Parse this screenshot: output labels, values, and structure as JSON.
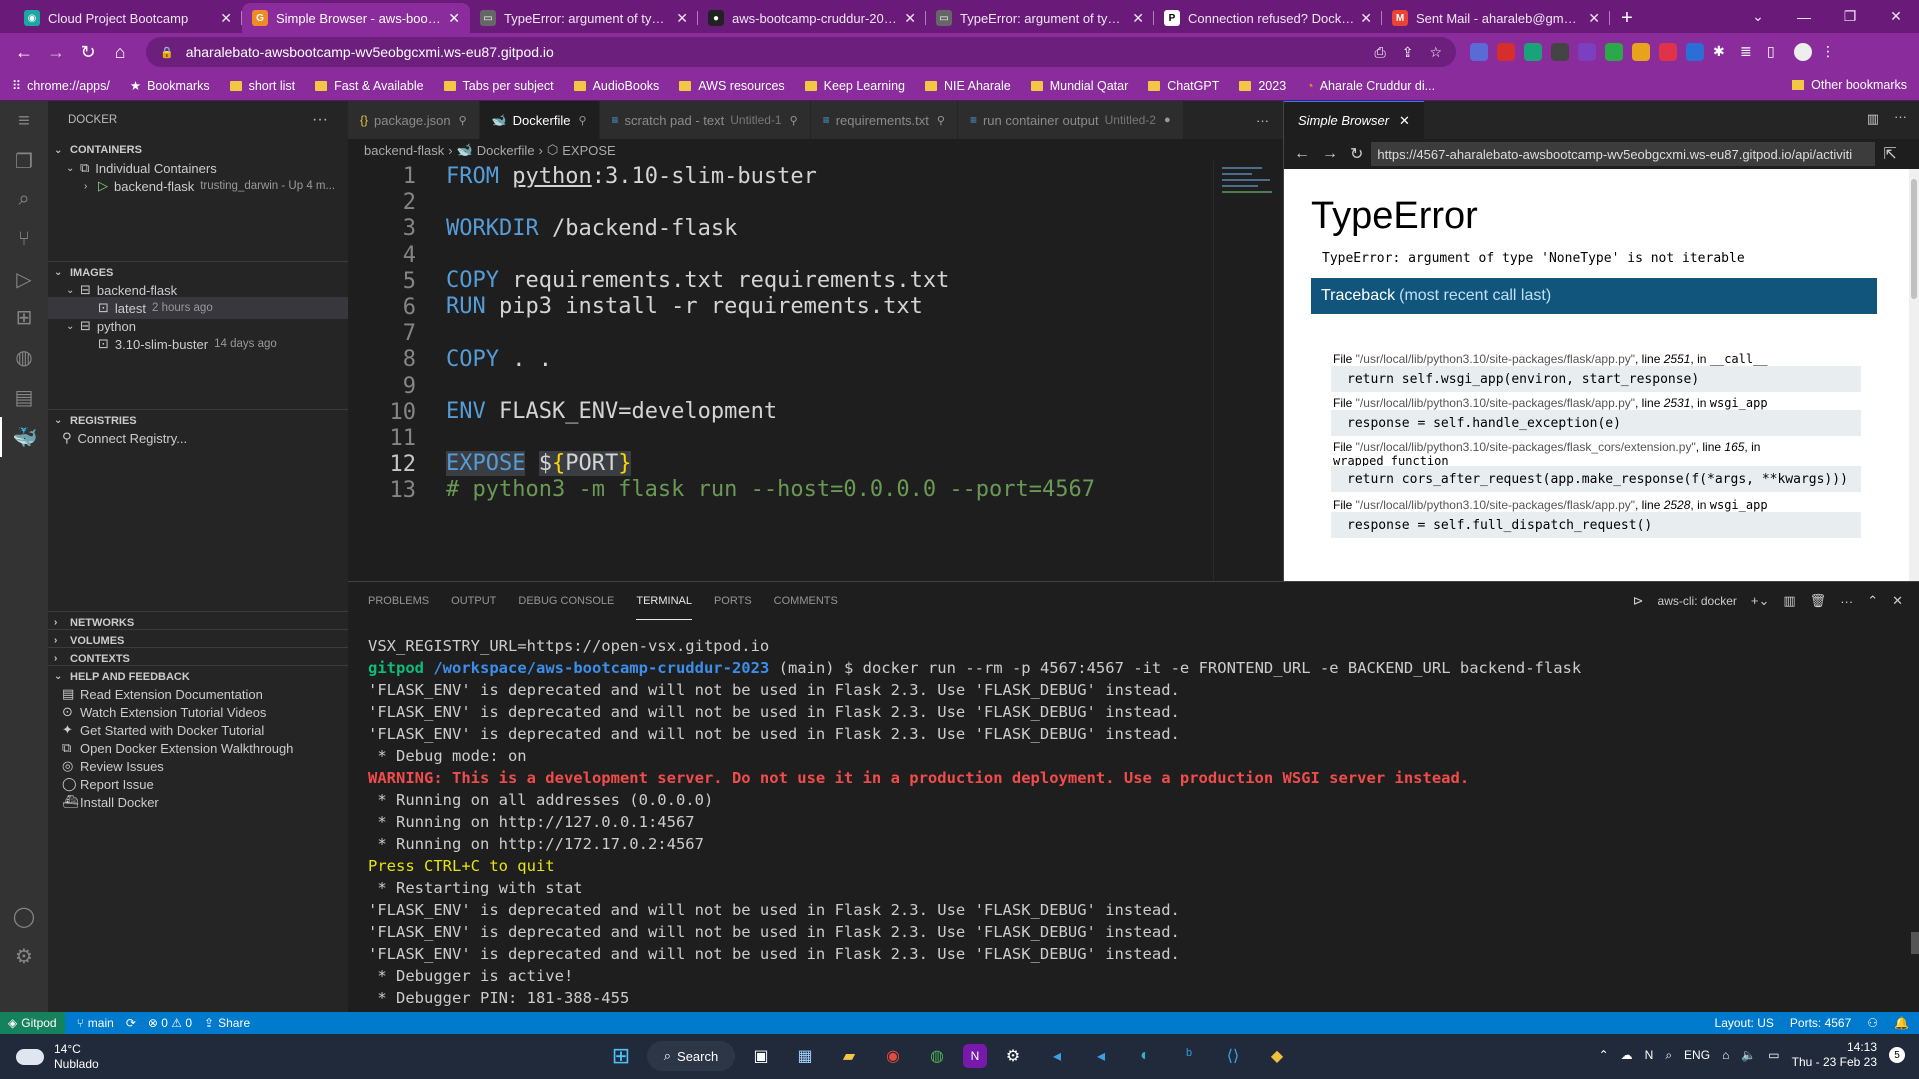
{
  "chrome": {
    "tabs": [
      {
        "title": "Cloud Project Bootcamp",
        "fav": "#1aa8a3",
        "glyph": "◉"
      },
      {
        "title": "Simple Browser - aws-bootcamp",
        "fav": "#f08a24",
        "glyph": "G",
        "active": true
      },
      {
        "title": "TypeError: argument of type 'N",
        "fav": "#666",
        "glyph": "▭"
      },
      {
        "title": "aws-bootcamp-cruddur-2023/",
        "fav": "#222",
        "glyph": "●"
      },
      {
        "title": "TypeError: argument of type 'N",
        "fav": "#666",
        "glyph": "▭"
      },
      {
        "title": "Connection refused? Docker ne",
        "fav": "#fff",
        "glyph": "P"
      },
      {
        "title": "Sent Mail - aharaleb@gmail.co",
        "fav": "#ea4335",
        "glyph": "M"
      }
    ],
    "new_tab": "+",
    "url": "aharalebato-awsbootcamp-wv5eobgcxmi.ws-eu87.gitpod.io",
    "bookmarks": [
      "chrome://apps/",
      "Bookmarks",
      "short list",
      "Fast & Available",
      "Tabs per subject",
      "AudioBooks",
      "AWS resources",
      "Keep Learning",
      "NIE Aharale",
      "Mundial Qatar",
      "ChatGPT",
      "2023",
      "Aharale Cruddur di..."
    ],
    "other_bookmarks": "Other bookmarks"
  },
  "sidebar": {
    "title": "DOCKER",
    "containers": "CONTAINERS",
    "individual": "Individual Containers",
    "container_name": "backend-flask",
    "container_status": "trusting_darwin - Up 4 m...",
    "images": "IMAGES",
    "img1": "backend-flask",
    "img1_tag": "latest",
    "img1_age": "2 hours ago",
    "img2": "python",
    "img2_tag": "3.10-slim-buster",
    "img2_age": "14 days ago",
    "registries": "REGISTRIES",
    "connect": "Connect Registry...",
    "networks": "NETWORKS",
    "volumes": "VOLUMES",
    "contexts": "CONTEXTS",
    "help": "HELP AND FEEDBACK",
    "help_items": [
      "Read Extension Documentation",
      "Watch Extension Tutorial Videos",
      "Get Started with Docker Tutorial",
      "Open Docker Extension Walkthrough",
      "Review Issues",
      "Report Issue",
      "Install Docker"
    ]
  },
  "editor": {
    "tabs": [
      {
        "label": "package.json",
        "icon": "{}"
      },
      {
        "label": "Dockerfile",
        "icon": "🐋",
        "active": true
      },
      {
        "label": "scratch pad - text",
        "dim": "Untitled-1",
        "icon": "≡"
      },
      {
        "label": "requirements.txt",
        "icon": "≡"
      },
      {
        "label": "run container output",
        "dim": "Untitled-2",
        "icon": "≡"
      }
    ],
    "crumbs": [
      "backend-flask",
      "Dockerfile",
      "EXPOSE"
    ],
    "line_numbers": [
      "1",
      "2",
      "3",
      "4",
      "5",
      "6",
      "7",
      "8",
      "9",
      "10",
      "11",
      "12",
      "13"
    ]
  },
  "simple_browser": {
    "tab": "Simple Browser",
    "url": "https://4567-aharalebato-awsbootcamp-wv5eobgcxmi.ws-eu87.gitpod.io/api/activiti",
    "title": "TypeError",
    "message": "TypeError: argument of type 'NoneType' is not iterable",
    "traceback": "Traceback",
    "traceback_sub": "(most recent call last)",
    "frames": [
      {
        "file": "\"/usr/local/lib/python3.10/site-packages/flask/app.py\"",
        "line": "2551",
        "fn": "__call__",
        "src": "return self.wsgi_app(environ, start_response)"
      },
      {
        "file": "\"/usr/local/lib/python3.10/site-packages/flask/app.py\"",
        "line": "2531",
        "fn": "wsgi_app",
        "src": "response = self.handle_exception(e)"
      },
      {
        "file": "\"/usr/local/lib/python3.10/site-packages/flask_cors/extension.py\"",
        "line": "165",
        "fn": "wrapped_function",
        "src": "return cors_after_request(app.make_response(f(*args, **kwargs)))"
      },
      {
        "file": "\"/usr/local/lib/python3.10/site-packages/flask/app.py\"",
        "line": "2528",
        "fn": "wsgi_app",
        "src": "response = self.full_dispatch_request()"
      }
    ]
  },
  "panel": {
    "tabs": [
      "PROBLEMS",
      "OUTPUT",
      "DEBUG CONSOLE",
      "TERMINAL",
      "PORTS",
      "COMMENTS"
    ],
    "active": "TERMINAL",
    "shell": "aws-cli: docker",
    "prompt_user": "gitpod",
    "prompt_path": "/workspace/aws-bootcamp-cruddur-2023",
    "prompt_branch": "(main) $",
    "command": "docker run --rm -p 4567:4567 -it -e FRONTEND_URL -e BACKEND_URL backend-flask",
    "lines": {
      "env1": "VSX_REGISTRY_URL=https://open-vsx.gitpod.io",
      "dep": "'FLASK_ENV' is deprecated and will not be used in Flask 2.3. Use 'FLASK_DEBUG' instead.",
      "debug": " * Debug mode: on",
      "warn": "WARNING: This is a development server. Do not use it in a production deployment. Use a production WSGI server instead.",
      "run1": " * Running on all addresses (0.0.0.0)",
      "run2": " * Running on http://127.0.0.1:4567",
      "run3": " * Running on http://172.17.0.2:4567",
      "quit": "Press CTRL+C to quit",
      "restart": " * Restarting with stat",
      "active": " * Debugger is active!",
      "pin": " * Debugger PIN: 181-388-455"
    }
  },
  "status": {
    "gitpod": "Gitpod",
    "branch": "main",
    "problems": "⊗ 0 ⚠ 0",
    "share": "Share",
    "layout": "Layout: US",
    "ports": "Ports: 4567"
  },
  "taskbar": {
    "temp": "14°C",
    "weather": "Nublado",
    "search": "Search",
    "lang": "ENG",
    "time": "14:13",
    "date": "Thu - 23 Feb 23",
    "notif": "5"
  }
}
